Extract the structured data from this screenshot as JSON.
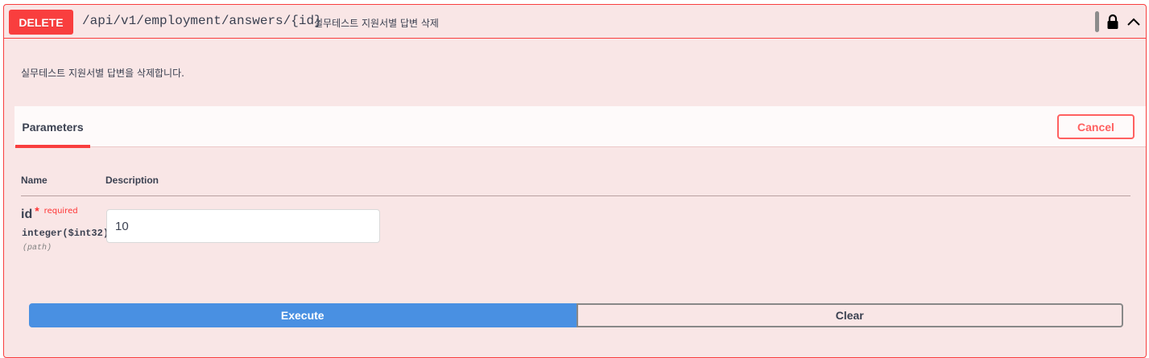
{
  "operation": {
    "method": "DELETE",
    "path": "/api/v1/employment/answers/{id}",
    "summary": "실무테스트 지원서별 답변 삭제",
    "description": "실무테스트 지원서별 답변을 삭제합니다."
  },
  "icons": {
    "copy": "copy-bar-icon",
    "lock": "lock-icon",
    "collapse": "chevron-up-icon"
  },
  "parameters_section": {
    "tab_label": "Parameters",
    "cancel_label": "Cancel",
    "columns": {
      "name": "Name",
      "description": "Description"
    },
    "params": [
      {
        "name": "id",
        "required_marker": "*",
        "required_label": "required",
        "type": "integer($int32)",
        "location": "(path)",
        "value": "10"
      }
    ]
  },
  "actions": {
    "execute_label": "Execute",
    "clear_label": "Clear"
  },
  "colors": {
    "delete_accent": "#f93e3e",
    "block_background": "#f9e6e6",
    "execute_blue": "#4990e2"
  }
}
